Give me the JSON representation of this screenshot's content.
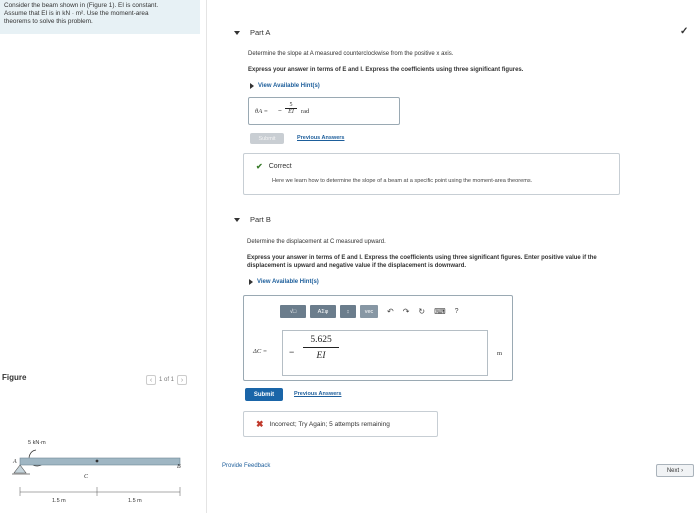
{
  "problem": {
    "line1": "Consider the beam shown in (Figure 1). EI is constant.",
    "line2": "Assume that EI is in kN · m². Use the moment-area",
    "line3": "theorems to solve this problem."
  },
  "figure": {
    "label": "Figure",
    "pager": "1 of 1",
    "load": "5 kN·m",
    "point_a": "A",
    "point_b": "B",
    "point_c": "C",
    "dim1": "1.5 m",
    "dim2": "1.5 m"
  },
  "part_a": {
    "title": "Part A",
    "question": "Determine the slope at A measured counterclockwise from the positive x axis.",
    "instructions": "Express your answer in terms of E and I. Express the coefficients using three significant figures.",
    "hints": "View Available Hint(s)",
    "answer_label": "θA =",
    "answer_sign": "−",
    "answer_num": "5",
    "answer_den": "EI",
    "answer_unit": "rad",
    "submit": "Submit",
    "previous": "Previous Answers",
    "correct_title": "Correct",
    "correct_body": "Here we learn how to determine the slope of a beam at a specific point using the moment-area theorems."
  },
  "part_b": {
    "title": "Part B",
    "question": "Determine the displacement at C measured upward.",
    "instructions1": "Express your answer in terms of E and I. Express the coefficients using three significant figures. Enter positive value if the",
    "instructions2": "displacement is upward and negative value if the displacement is downward.",
    "hints": "View Available Hint(s)",
    "toolbar": [
      "√□",
      "ΑΣφ",
      "↕",
      "vec"
    ],
    "answer_label": "ΔC =",
    "answer_sign": "−",
    "answer_num": "5.625",
    "answer_den": "EI",
    "answer_unit": "m",
    "submit": "Submit",
    "previous": "Previous Answers",
    "incorrect": "Incorrect; Try Again; 5 attempts remaining"
  },
  "footer": {
    "feedback": "Provide Feedback",
    "next": "Next"
  }
}
